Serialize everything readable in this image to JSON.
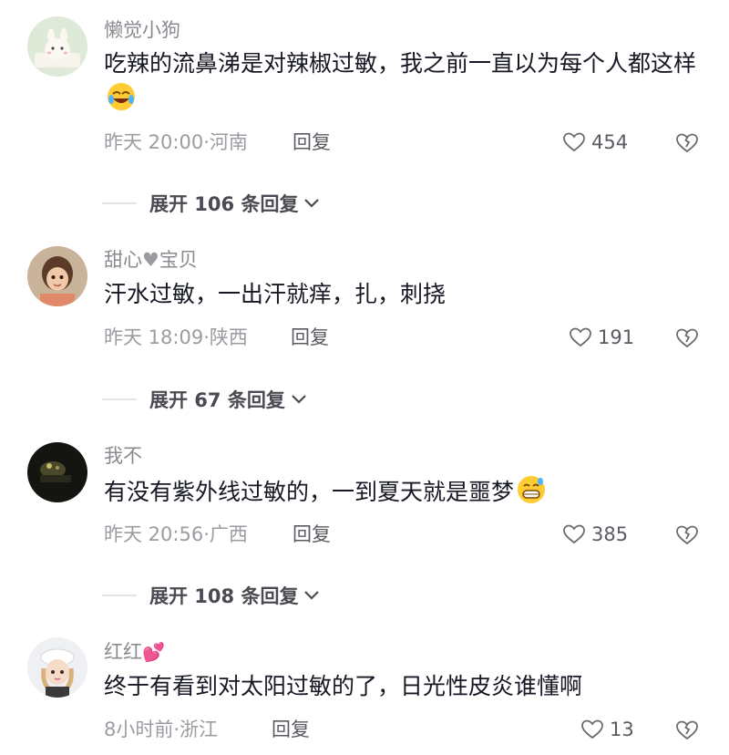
{
  "comments": [
    {
      "username": "懒觉小狗",
      "text": "吃辣的流鼻涕是对辣椒过敏，我之前一直以为每个人都这样",
      "emoji": "rolling-laughing-emoji",
      "time_location": "昨天 20:00·河南",
      "reply_label": "回复",
      "likes": "454",
      "expand_label": "展开 106 条回复"
    },
    {
      "username_before": "甜心",
      "username_heart": "♥",
      "username_after": "宝贝",
      "text": "汗水过敏，一出汗就痒，扎，刺挠",
      "time_location": "昨天 18:09·陕西",
      "reply_label": "回复",
      "likes": "191",
      "expand_label": "展开 67 条回复"
    },
    {
      "username": "我不",
      "text": "有没有紫外线过敏的，一到夏天就是噩梦",
      "emoji": "grinning-sweat-emoji",
      "time_location": "昨天 20:56·广西",
      "reply_label": "回复",
      "likes": "385",
      "expand_label": "展开 108 条回复"
    },
    {
      "username": "红红",
      "username_emoji": "💕",
      "text": "终于有看到对太阳过敏的了，日光性皮炎谁懂啊",
      "time_location": "8小时前·浙江",
      "reply_label": "回复",
      "likes": "13"
    }
  ],
  "colors": {
    "text": "#161823",
    "secondary": "#9b9ca2",
    "username": "#8a8b91",
    "divider": "#e4e4e7"
  }
}
